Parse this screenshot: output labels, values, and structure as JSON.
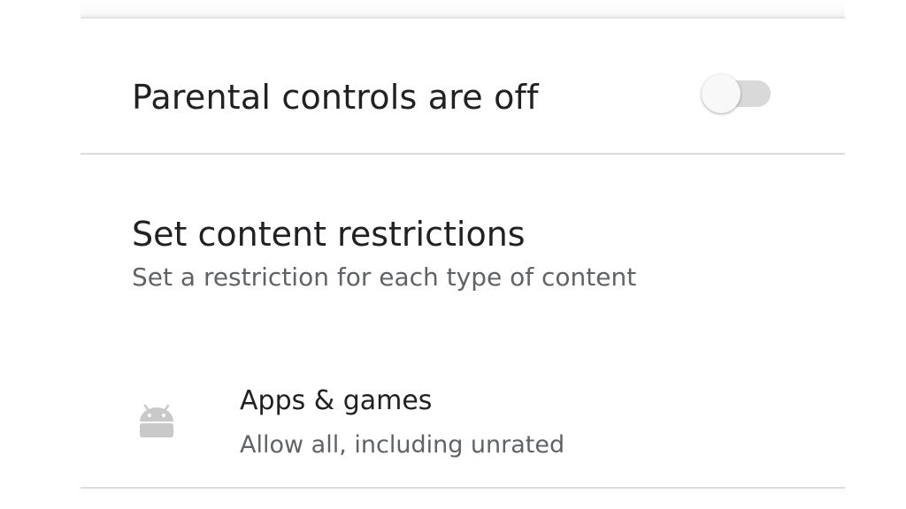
{
  "parental_controls": {
    "label": "Parental controls are off",
    "enabled": false
  },
  "content_restrictions": {
    "title": "Set content restrictions",
    "subtitle": "Set a restriction for each type of content",
    "items": [
      {
        "icon": "android-icon",
        "title": "Apps & games",
        "subtitle": "Allow all, including unrated"
      }
    ]
  },
  "colors": {
    "primary_text": "#202124",
    "secondary_text": "#5f6368",
    "divider": "#dcdcdc",
    "switch_track_off": "#d9d9d9",
    "icon_gray": "#c9c9c9"
  }
}
